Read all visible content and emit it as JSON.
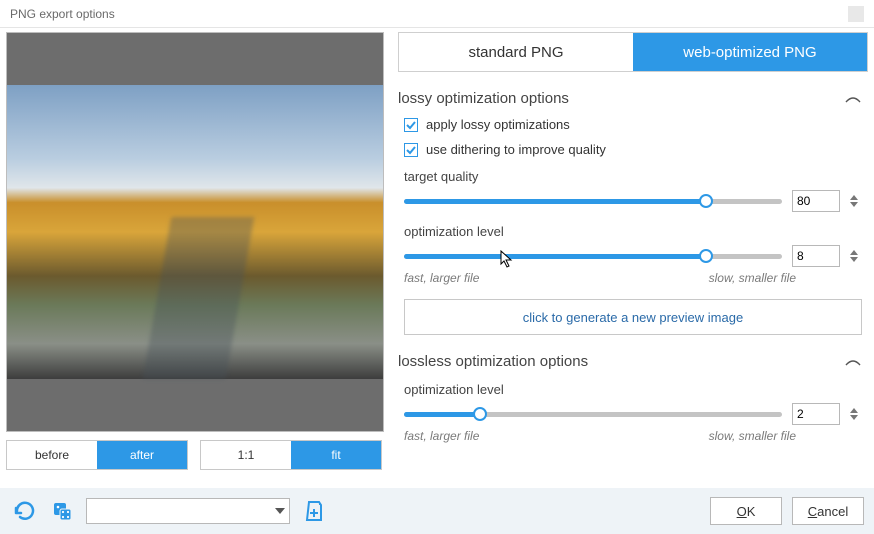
{
  "window": {
    "title": "PNG export options"
  },
  "tabs": {
    "standard": "standard PNG",
    "web": "web-optimized PNG",
    "active": "web"
  },
  "preview_toggles": {
    "before": "before",
    "after": "after",
    "active_ba": "after",
    "oneToOne": "1:1",
    "fit": "fit",
    "active_zoom": "fit"
  },
  "sections": {
    "lossy": {
      "title": "lossy optimization options",
      "apply_lossy": {
        "label": "apply lossy optimizations",
        "checked": true
      },
      "dithering": {
        "label": "use dithering to improve quality",
        "checked": true
      },
      "target_quality": {
        "label": "target quality",
        "value": 80,
        "min": 0,
        "max": 100
      },
      "opt_level": {
        "label": "optimization level",
        "value": 8,
        "min": 0,
        "max": 10,
        "hint_left": "fast, larger file",
        "hint_right": "slow, smaller file"
      },
      "gen_button": "click to generate a new preview image"
    },
    "lossless": {
      "title": "lossless optimization options",
      "opt_level": {
        "label": "optimization level",
        "value": 2,
        "min": 0,
        "max": 10,
        "hint_left": "fast, larger file",
        "hint_right": "slow, smaller file"
      }
    }
  },
  "footer": {
    "ok_prefix": "O",
    "ok_rest": "K",
    "cancel_prefix": "C",
    "cancel_rest": "ancel",
    "preset_value": ""
  }
}
